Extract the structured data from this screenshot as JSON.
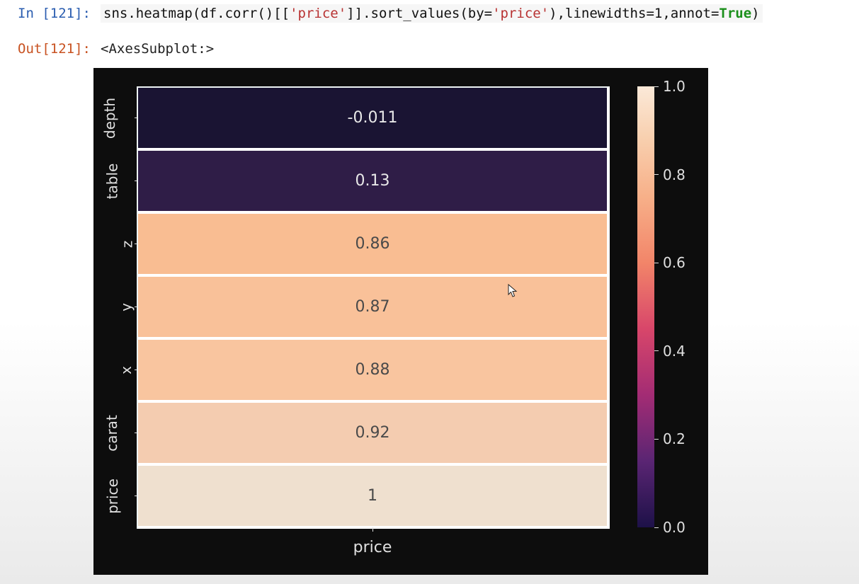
{
  "input": {
    "prompt": "In [121]:",
    "code_prefix": "sns.heatmap(df.corr()[[",
    "code_str1": "'price'",
    "code_mid": "]].sort_values(by=",
    "code_str2": "'price'",
    "code_suffix": "),linewidths=1,annot=",
    "code_kw": "True",
    "code_end": ")"
  },
  "output": {
    "prompt": "Out[121]:",
    "text": "<AxesSubplot:>"
  },
  "chart_data": {
    "type": "heatmap",
    "xlabel": "price",
    "ylabels": [
      "depth",
      "table",
      "z",
      "y",
      "x",
      "carat",
      "price"
    ],
    "values": [
      -0.011,
      0.13,
      0.86,
      0.87,
      0.88,
      0.92,
      1
    ],
    "annotations": [
      "-0.011",
      "0.13",
      "0.86",
      "0.87",
      "0.88",
      "0.92",
      "1"
    ],
    "cell_colors": [
      "#1a1433",
      "#2f1d47",
      "#f9bd92",
      "#f9c199",
      "#f9c59f",
      "#f4ccb0",
      "#efe0cf"
    ],
    "text_colors": [
      "#e8e8e8",
      "#e8e8e8",
      "#4a4a4a",
      "#4a4a4a",
      "#4a4a4a",
      "#4a4a4a",
      "#4a4a4a"
    ],
    "colorbar": {
      "min": 0.0,
      "max": 1.0,
      "ticks": [
        0.0,
        0.2,
        0.4,
        0.6,
        0.8,
        1.0
      ],
      "tick_labels": [
        "0.0",
        "0.2",
        "0.4",
        "0.6",
        "0.8",
        "1.0"
      ],
      "stops": [
        {
          "p": 0,
          "c": "#fbe9d8"
        },
        {
          "p": 12,
          "c": "#f8cfae"
        },
        {
          "p": 25,
          "c": "#f7b089"
        },
        {
          "p": 40,
          "c": "#f28569"
        },
        {
          "p": 55,
          "c": "#d8466a"
        },
        {
          "p": 70,
          "c": "#a32c74"
        },
        {
          "p": 85,
          "c": "#5a2573"
        },
        {
          "p": 100,
          "c": "#1d1148"
        }
      ]
    }
  }
}
